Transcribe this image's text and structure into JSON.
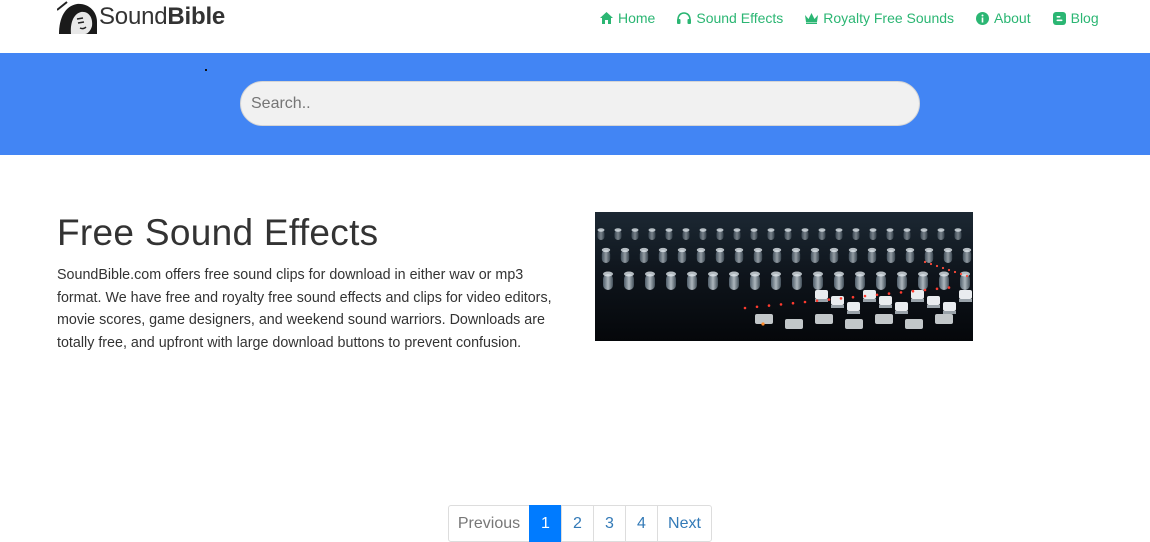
{
  "header": {
    "logo_light": "Sound",
    "logo_bold": "Bible",
    "nav": [
      {
        "label": "Home",
        "icon": "home-icon"
      },
      {
        "label": "Sound Effects",
        "icon": "headset-icon"
      },
      {
        "label": "Royalty Free Sounds",
        "icon": "crown-icon"
      },
      {
        "label": "About",
        "icon": "info-circle-icon"
      },
      {
        "label": "Blog",
        "icon": "blogger-icon"
      }
    ],
    "nav_color": "#2bb673"
  },
  "search": {
    "placeholder": "Search..",
    "value": "",
    "banner_color": "#4285f4"
  },
  "main": {
    "title": "Free Sound Effects",
    "description": "SoundBible.com offers free sound clips for download in either wav or mp3 format. We have free and royalty free sound effects and clips for video editors, movie scores, game designers, and weekend sound warriors. Downloads are totally free, and upfront with large download buttons to prevent confusion."
  },
  "pagination": {
    "previous": "Previous",
    "pages": [
      "1",
      "2",
      "3",
      "4"
    ],
    "active": "1",
    "next": "Next",
    "active_color": "#007bff"
  }
}
